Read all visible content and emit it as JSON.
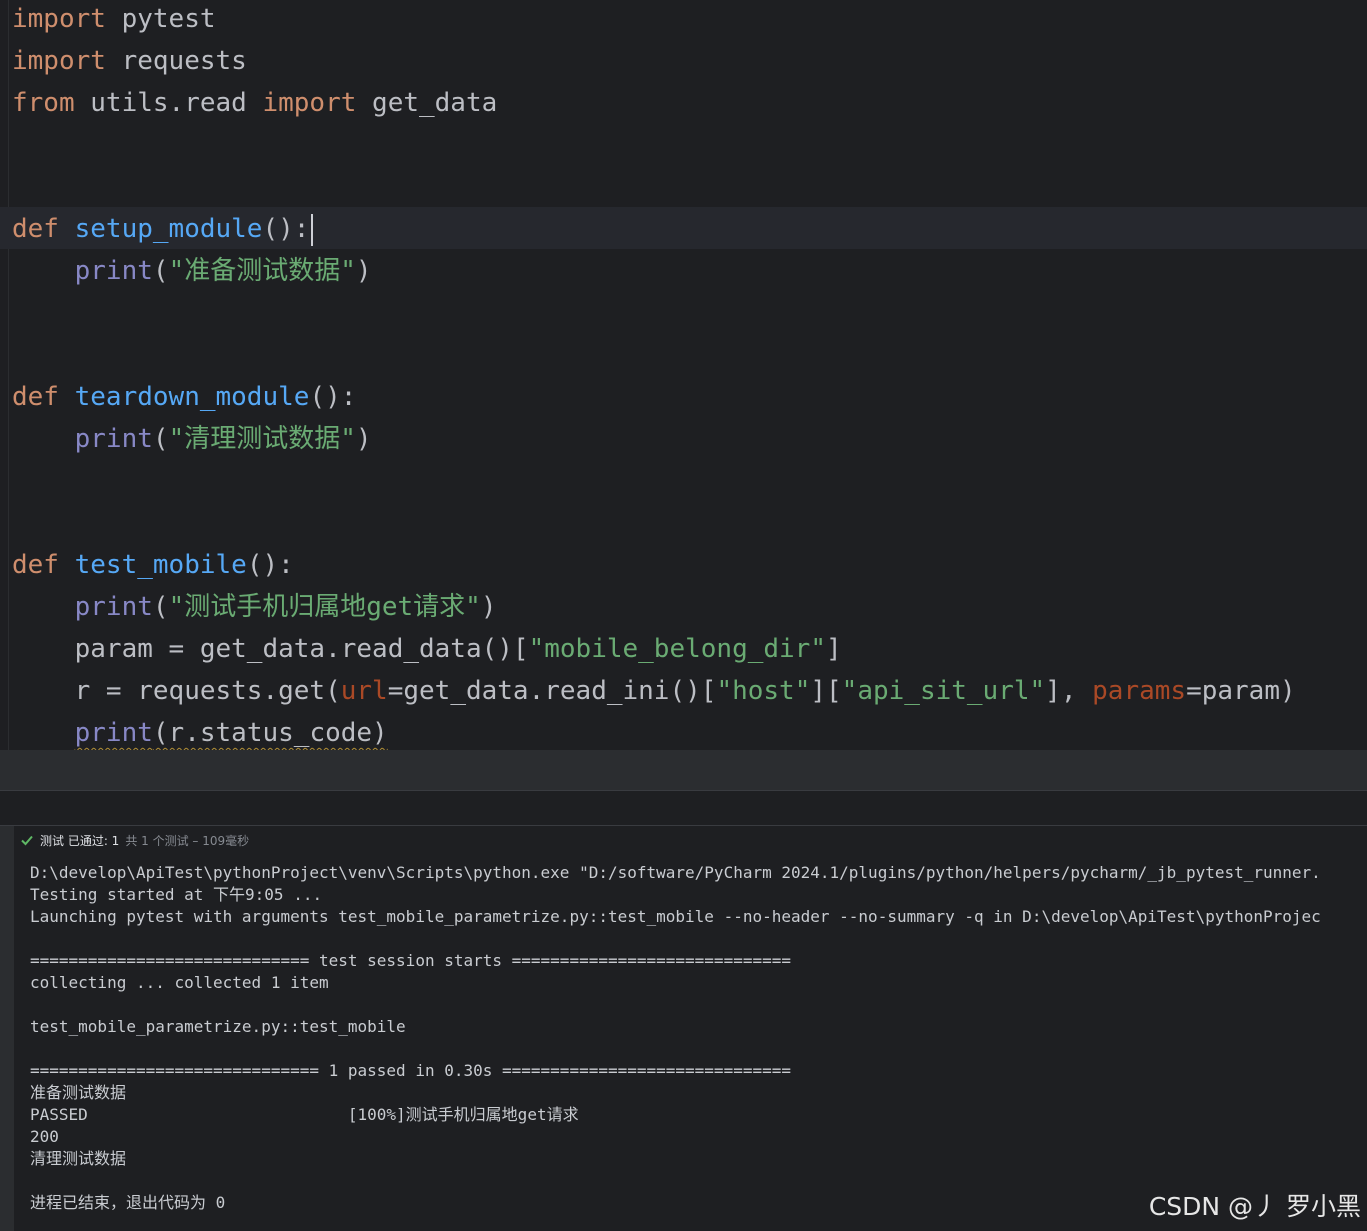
{
  "editor": {
    "lines": {
      "l1": {
        "kw": "import",
        "mod": " pytest"
      },
      "l2": {
        "kw": "import",
        "mod": " requests"
      },
      "l3": {
        "kw1": "from",
        "mod": " utils.read ",
        "kw2": "import",
        "name": " get_data"
      },
      "setup": {
        "kw": "def",
        "fn": "setup_module",
        "tail": "():"
      },
      "setup_print": {
        "bi": "print",
        "open": "(",
        "str": "\"准备测试数据\"",
        "close": ")"
      },
      "teardown": {
        "kw": "def",
        "fn": "teardown_module",
        "tail": "():"
      },
      "teardown_print": {
        "bi": "print",
        "open": "(",
        "str": "\"清理测试数据\"",
        "close": ")"
      },
      "test": {
        "kw": "def",
        "fn": "test_mobile",
        "tail": "():"
      },
      "test_print": {
        "bi": "print",
        "open": "(",
        "str": "\"测试手机归属地get请求\"",
        "close": ")"
      },
      "param": {
        "a": "param = get_data.read_data()[",
        "str": "\"mobile_belong_dir\"",
        "b": "]"
      },
      "request": {
        "a": "r = requests.get(",
        "kw_url": "url",
        "b": "=get_data.read_ini()[",
        "s1": "\"host\"",
        "c": "][",
        "s2": "\"api_sit_url\"",
        "d": "], ",
        "kw_params": "params",
        "e": "=param)"
      },
      "status_print": {
        "bi": "print",
        "rest": "(r.status_code)"
      }
    }
  },
  "run_panel": {
    "status": {
      "icon": "check-icon",
      "label": "测试 已通过: 1",
      "detail": "共 1 个测试 – 109毫秒",
      "color": "#5fb865"
    },
    "console": [
      "D:\\develop\\ApiTest\\pythonProject\\venv\\Scripts\\python.exe \"D:/software/PyCharm 2024.1/plugins/python/helpers/pycharm/_jb_pytest_runner.",
      "Testing started at 下午9:05 ...",
      "Launching pytest with arguments test_mobile_parametrize.py::test_mobile --no-header --no-summary -q in D:\\develop\\ApiTest\\pythonProjec",
      "",
      "============================= test session starts =============================",
      "collecting ... collected 1 item",
      "",
      "test_mobile_parametrize.py::test_mobile",
      "",
      "============================== 1 passed in 0.30s ==============================",
      "准备测试数据",
      "PASSED                           [100%]测试手机归属地get请求",
      "200",
      "清理测试数据",
      "",
      "进程已结束，退出代码为 0"
    ]
  },
  "watermark": "CSDN @丿 罗小黑"
}
